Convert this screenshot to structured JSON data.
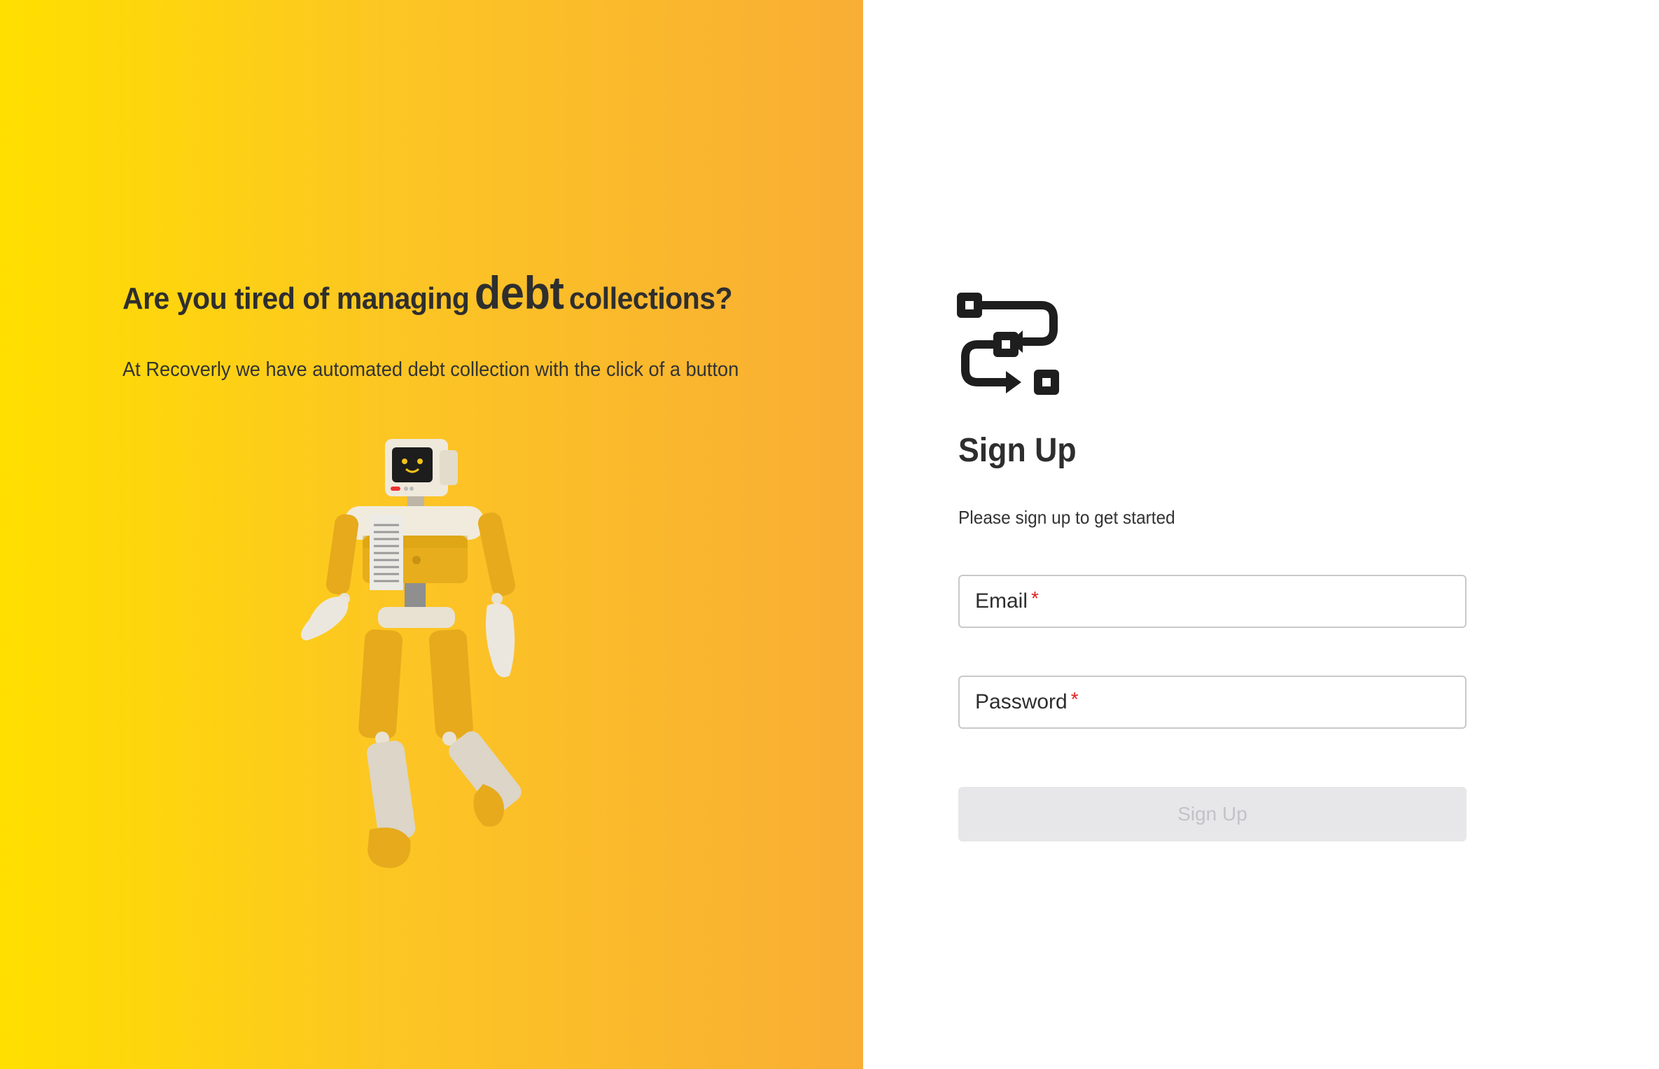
{
  "hero": {
    "title_before": "Are you tired of managing",
    "title_emphasis": "debt",
    "title_after": "collections?",
    "subtitle": "At Recoverly we have automated debt collection with the click of a button",
    "illustration": "robot-illustration",
    "gradient": [
      "#ffdf00",
      "#fcc623",
      "#f9ad35"
    ]
  },
  "form": {
    "logo_icon": "workflow-icon",
    "title": "Sign Up",
    "subtitle": "Please sign up to get started",
    "fields": [
      {
        "label": "Email",
        "required_mark": "*",
        "value": ""
      },
      {
        "label": "Password",
        "required_mark": "*",
        "value": ""
      }
    ],
    "submit_label": "Sign Up",
    "submit_disabled": true
  },
  "colors": {
    "required": "#e02020",
    "text": "#2e2e2e",
    "disabled_bg": "#e7e7e9",
    "disabled_text": "#c2c3c6"
  }
}
